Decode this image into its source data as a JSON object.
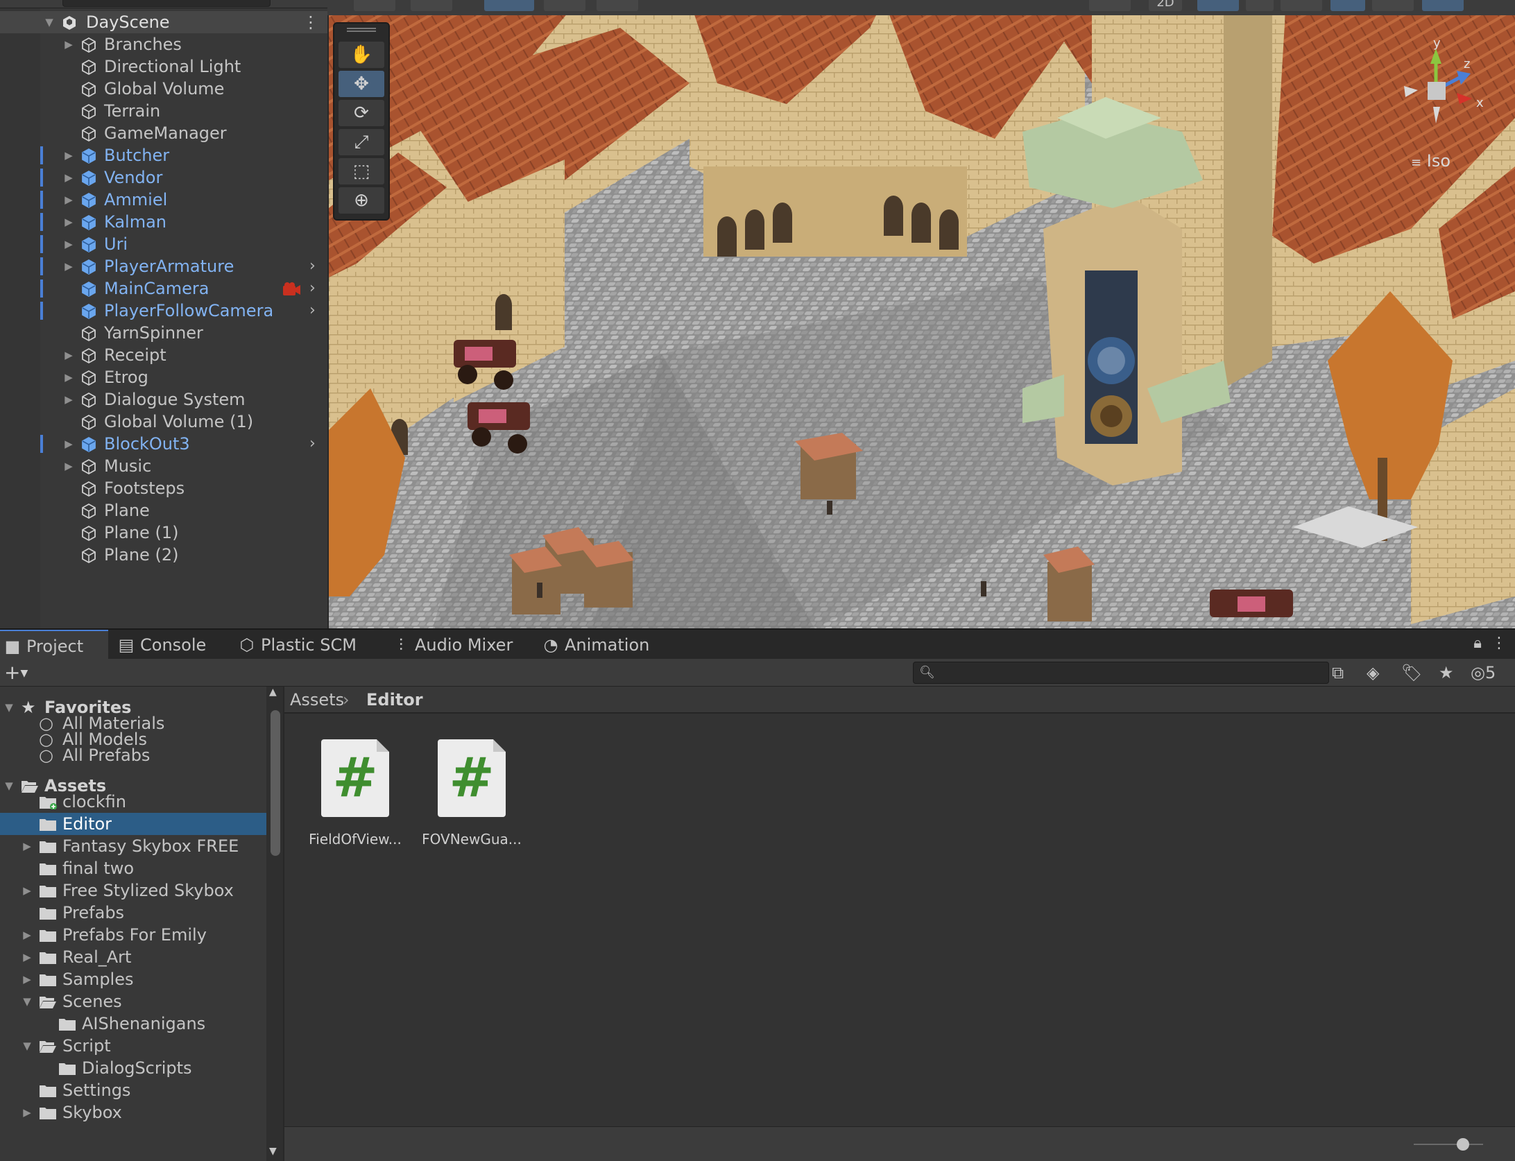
{
  "hierarchy": {
    "scene_name": "DayScene",
    "items": [
      {
        "label": "Branches",
        "prefab": false,
        "expandable": true,
        "chevron": false
      },
      {
        "label": "Directional Light",
        "prefab": false,
        "expandable": false,
        "chevron": false
      },
      {
        "label": "Global Volume",
        "prefab": false,
        "expandable": false,
        "chevron": false
      },
      {
        "label": "Terrain",
        "prefab": false,
        "expandable": false,
        "chevron": false
      },
      {
        "label": "GameManager",
        "prefab": false,
        "expandable": false,
        "chevron": false
      },
      {
        "label": "Butcher",
        "prefab": true,
        "expandable": true,
        "chevron": false
      },
      {
        "label": "Vendor",
        "prefab": true,
        "expandable": true,
        "chevron": false
      },
      {
        "label": "Ammiel",
        "prefab": true,
        "expandable": true,
        "chevron": false
      },
      {
        "label": "Kalman",
        "prefab": true,
        "expandable": true,
        "chevron": false
      },
      {
        "label": "Uri",
        "prefab": true,
        "expandable": true,
        "chevron": false
      },
      {
        "label": "PlayerArmature",
        "prefab": true,
        "expandable": true,
        "chevron": true
      },
      {
        "label": "MainCamera",
        "prefab": true,
        "expandable": false,
        "chevron": true,
        "camera_icon": true
      },
      {
        "label": "PlayerFollowCamera",
        "prefab": true,
        "expandable": false,
        "chevron": true
      },
      {
        "label": "YarnSpinner",
        "prefab": false,
        "expandable": false,
        "chevron": false
      },
      {
        "label": "Receipt",
        "prefab": false,
        "expandable": true,
        "chevron": false
      },
      {
        "label": "Etrog",
        "prefab": false,
        "expandable": true,
        "chevron": false
      },
      {
        "label": "Dialogue System",
        "prefab": false,
        "expandable": true,
        "chevron": false
      },
      {
        "label": "Global Volume (1)",
        "prefab": false,
        "expandable": false,
        "chevron": false
      },
      {
        "label": "BlockOut3",
        "prefab": true,
        "expandable": true,
        "chevron": true
      },
      {
        "label": "Music",
        "prefab": false,
        "expandable": true,
        "chevron": false
      },
      {
        "label": "Footsteps",
        "prefab": false,
        "expandable": false,
        "chevron": false
      },
      {
        "label": "Plane",
        "prefab": false,
        "expandable": false,
        "chevron": false
      },
      {
        "label": "Plane (1)",
        "prefab": false,
        "expandable": false,
        "chevron": false
      },
      {
        "label": "Plane (2)",
        "prefab": false,
        "expandable": false,
        "chevron": false
      }
    ]
  },
  "scene_view": {
    "toolbar_2d_label": "2D",
    "projection_label": "Iso",
    "gizmo_axes": {
      "y": "y",
      "z": "z",
      "x": "x"
    },
    "active_tool": "move-tool"
  },
  "bottom_tabs": [
    {
      "label": "Project",
      "icon": "folder-icon",
      "active": true
    },
    {
      "label": "Console",
      "icon": "console-icon",
      "active": false
    },
    {
      "label": "Plastic SCM",
      "icon": "plastic-scm-icon",
      "active": false
    },
    {
      "label": "Audio Mixer",
      "icon": "audio-mixer-icon",
      "active": false
    },
    {
      "label": "Animation",
      "icon": "animation-icon",
      "active": false
    }
  ],
  "project": {
    "hidden_count": "5",
    "favorites": {
      "label": "Favorites",
      "items": [
        "All Materials",
        "All Models",
        "All Prefabs"
      ]
    },
    "assets_label": "Assets",
    "tree": [
      {
        "label": "clockfin",
        "depth": 1,
        "arrow": "",
        "selected": false,
        "badge": true
      },
      {
        "label": "Editor",
        "depth": 1,
        "arrow": "",
        "selected": true
      },
      {
        "label": "Fantasy Skybox FREE",
        "depth": 1,
        "arrow": "right",
        "selected": false
      },
      {
        "label": "final two",
        "depth": 1,
        "arrow": "",
        "selected": false
      },
      {
        "label": "Free Stylized Skybox",
        "depth": 1,
        "arrow": "right",
        "selected": false
      },
      {
        "label": "Prefabs",
        "depth": 1,
        "arrow": "",
        "selected": false
      },
      {
        "label": "Prefabs For Emily",
        "depth": 1,
        "arrow": "right",
        "selected": false
      },
      {
        "label": "Real_Art",
        "depth": 1,
        "arrow": "right",
        "selected": false
      },
      {
        "label": "Samples",
        "depth": 1,
        "arrow": "right",
        "selected": false
      },
      {
        "label": "Scenes",
        "depth": 1,
        "arrow": "down",
        "selected": false,
        "open": true
      },
      {
        "label": "AIShenanigans",
        "depth": 2,
        "arrow": "",
        "selected": false
      },
      {
        "label": "Script",
        "depth": 1,
        "arrow": "down",
        "selected": false,
        "open": true
      },
      {
        "label": "DialogScripts",
        "depth": 2,
        "arrow": "",
        "selected": false
      },
      {
        "label": "Settings",
        "depth": 1,
        "arrow": "",
        "selected": false
      },
      {
        "label": "Skybox",
        "depth": 1,
        "arrow": "right",
        "selected": false
      }
    ],
    "breadcrumb": [
      "Assets",
      "Editor"
    ],
    "files": [
      {
        "name": "FieldOfView...",
        "type": "C# script"
      },
      {
        "name": "FOVNewGua...",
        "type": "C# script"
      }
    ]
  },
  "colors": {
    "prefab_text": "#82b3f2",
    "selection": "#2c5d87",
    "accent_bar": "#4a7fd6",
    "script_hash": "#3f8e2f"
  }
}
